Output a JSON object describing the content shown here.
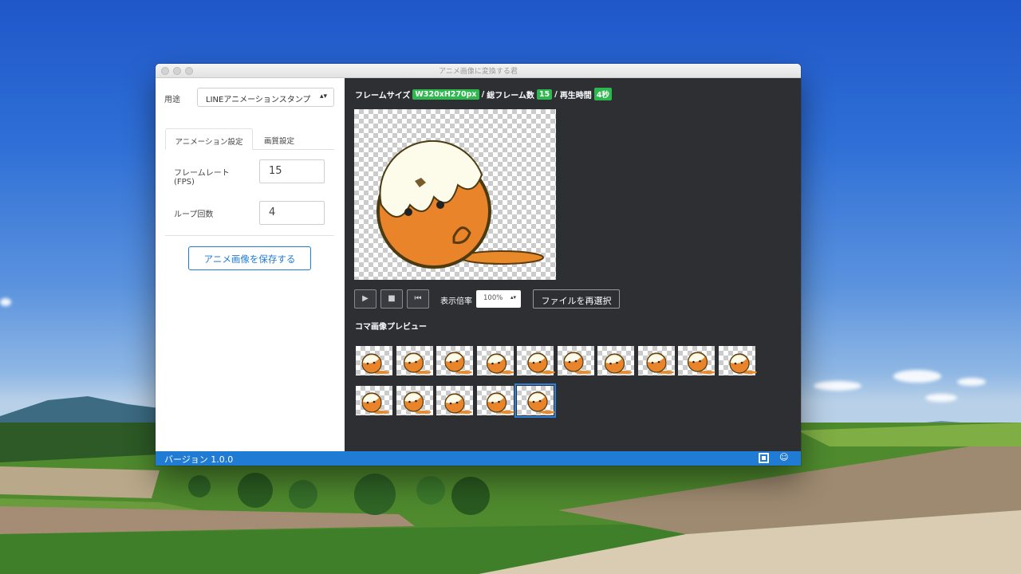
{
  "window": {
    "title": "アニメ画像に変換する君"
  },
  "sidebar": {
    "usage_label": "用途",
    "usage_value": "LINEアニメーションスタンプ",
    "tabs": [
      {
        "label": "アニメーション設定",
        "active": true
      },
      {
        "label": "画質設定",
        "active": false
      }
    ],
    "fps_label_line1": "フレームレート",
    "fps_label_line2": "(FPS)",
    "fps_value": "15",
    "loop_label": "ループ回数",
    "loop_value": "4",
    "save_button": "アニメ画像を保存する"
  },
  "info_bar": {
    "frame_size_label": "フレームサイズ",
    "frame_size_value": "W320xH270px",
    "sep1": "/",
    "total_frames_label": "総フレーム数",
    "total_frames_value": "15",
    "sep2": "/",
    "play_time_label": "再生時間",
    "play_time_value": "4秒"
  },
  "controls": {
    "play_icon": "play-icon",
    "stop_icon": "stop-icon",
    "rewind_icon": "skip-back-icon",
    "zoom_label": "表示倍率",
    "zoom_value": "100%",
    "reselect_button": "ファイルを再選択"
  },
  "frames_section": {
    "title": "コマ画像プレビュー",
    "frame_count": 15,
    "selected_index": 14
  },
  "status_bar": {
    "version": "バージョン 1.0.0",
    "icons": [
      "window-mode-icon",
      "smiley-icon"
    ]
  },
  "colors": {
    "accent": "#1f7bd3",
    "badge_green": "#2db84d",
    "dark_panel": "#2e2f33"
  }
}
